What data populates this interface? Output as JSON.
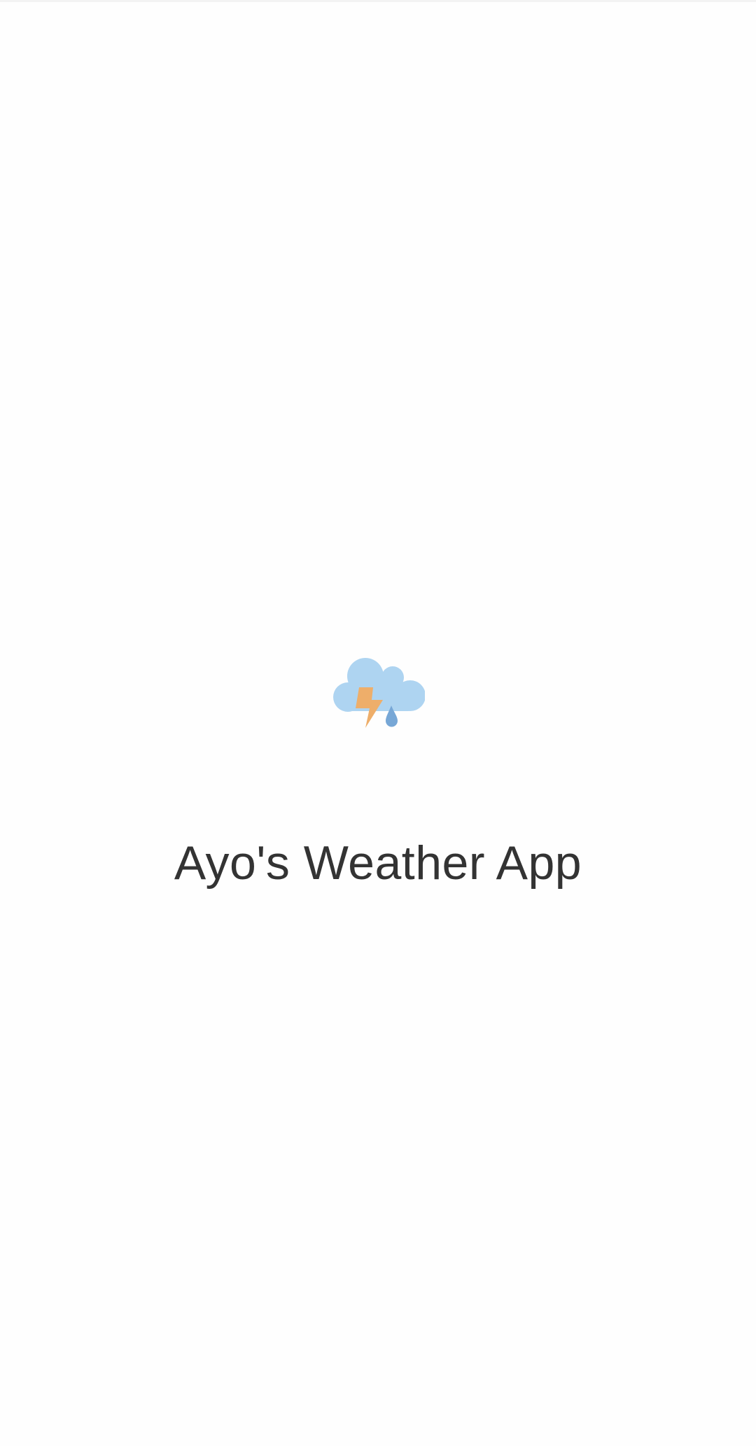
{
  "splash": {
    "app_name": "Ayo's Weather App",
    "logo_icon": "cloud-lightning-rain-icon",
    "colors": {
      "cloud": "#aed4f1",
      "lightning": "#eeae6a",
      "raindrop": "#77a7d6",
      "title_text": "#333333",
      "background": "#fefefe"
    }
  }
}
